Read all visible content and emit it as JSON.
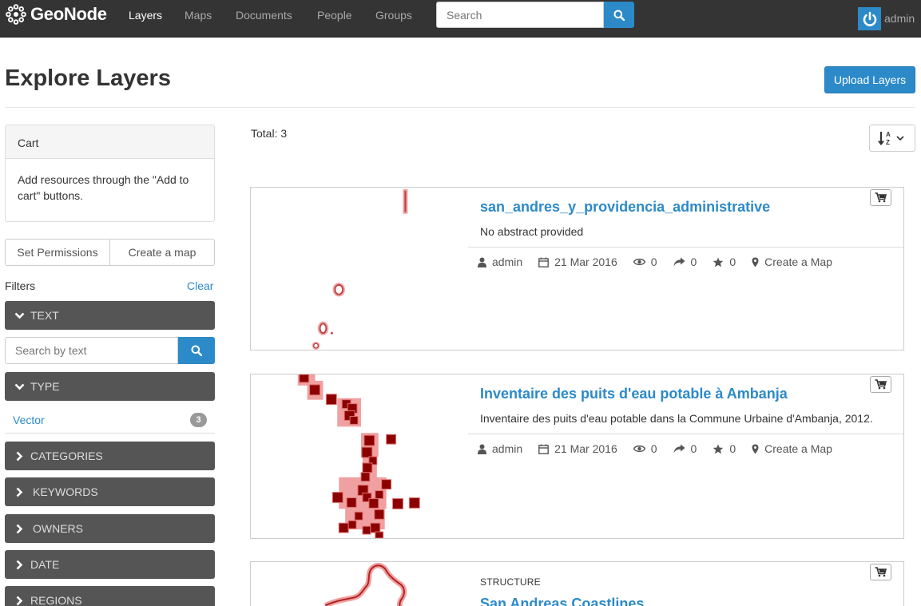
{
  "nav": {
    "brand": "GeoNode",
    "links": [
      "Layers",
      "Maps",
      "Documents",
      "People",
      "Groups"
    ],
    "search_placeholder": "Search",
    "user": "admin"
  },
  "header": {
    "title": "Explore Layers",
    "upload_label": "Upload Layers"
  },
  "sidebar": {
    "cart_title": "Cart",
    "cart_text": "Add resources through the \"Add to cart\" buttons.",
    "set_permissions": "Set Permissions",
    "create_map": "Create a map",
    "filters_label": "Filters",
    "clear_label": "Clear",
    "facets": {
      "text": "TEXT",
      "type": "TYPE",
      "categories": "CATEGORIES",
      "keywords": "KEYWORDS",
      "owners": "OWNERS",
      "date": "DATE",
      "regions": "REGIONS"
    },
    "text_search_placeholder": "Search by text",
    "type_option": "Vector",
    "type_count": "3"
  },
  "main": {
    "total": "Total: 3",
    "layers": [
      {
        "title": "san_andres_y_providencia_administrative",
        "abstract": "No abstract provided",
        "owner": "admin",
        "date": "21 Mar 2016",
        "views": "0",
        "shares": "0",
        "rating": "0",
        "create_map": "Create a Map"
      },
      {
        "title": "Inventaire des puits d'eau potable à Ambanja",
        "abstract": "Inventaire des puits d'eau potable dans la Commune Urbaine d'Ambanja, 2012.",
        "owner": "admin",
        "date": "21 Mar 2016",
        "views": "0",
        "shares": "0",
        "rating": "0",
        "create_map": "Create a Map"
      },
      {
        "category": "STRUCTURE",
        "title": "San Andreas Coastlines"
      }
    ]
  },
  "colors": {
    "navbar": "#343434",
    "accent": "#2c8ac9",
    "facet": "#555555",
    "feature_fill": "#8b0000",
    "feature_halo": "#f0a0a0"
  }
}
